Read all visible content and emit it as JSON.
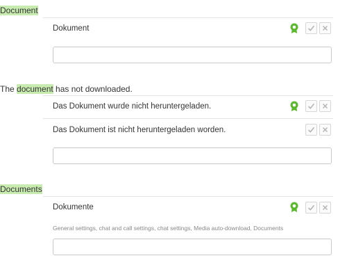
{
  "sections": [
    {
      "source_parts": [
        "Document"
      ],
      "translations": [
        {
          "text": "Dokument",
          "approved": true
        }
      ],
      "input_value": ""
    },
    {
      "source_parts": [
        "The ",
        "document",
        " has not downloaded."
      ],
      "translations": [
        {
          "text": "Das Dokument wurde nicht heruntergeladen.",
          "approved": true
        },
        {
          "text": "Das Dokument ist nicht heruntergeladen worden.",
          "approved": false
        }
      ],
      "input_value": ""
    },
    {
      "source_parts": [
        "Documents"
      ],
      "translations": [
        {
          "text": "Dokumente",
          "approved": true
        }
      ],
      "context": "General settings, chat and call settings, chat settings, Media auto-download, Documents",
      "input_value": ""
    }
  ],
  "colors": {
    "highlight": "#c8ecb0",
    "approved_icon": "#5cb82e"
  },
  "icons": {
    "approved": "approved-badge-icon",
    "accept": "check-icon",
    "reject": "close-icon"
  }
}
